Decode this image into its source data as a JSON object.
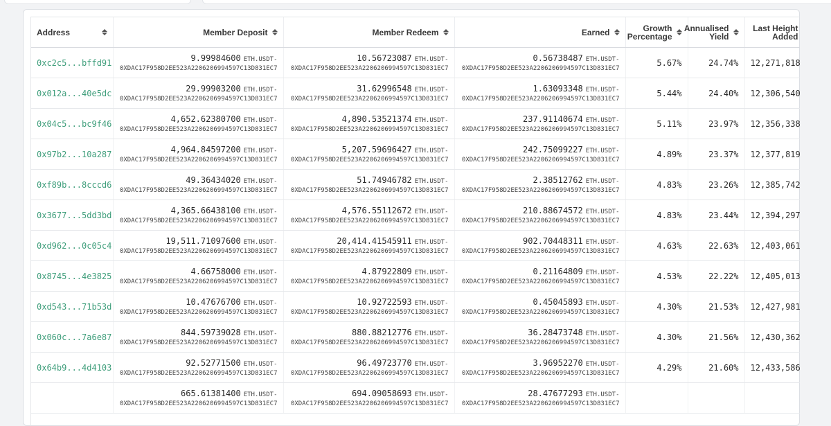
{
  "columns": {
    "address": "Address",
    "deposit": "Member Deposit",
    "redeem": "Member Redeem",
    "earned": "Earned",
    "growth": [
      "Growth",
      "Percentage"
    ],
    "yield": [
      "Annualised",
      "Yield"
    ],
    "height": [
      "Last Height",
      "Added"
    ]
  },
  "token": {
    "prefix": "ETH.USDT-",
    "address": "0XDAC17F958D2EE523A2206206994597C13D831EC7"
  },
  "rows": [
    {
      "address": "0xc2c5...bffd91",
      "deposit": "9.99984600",
      "redeem": "10.56723087",
      "earned": "0.56738487",
      "growth": "5.67%",
      "yield": "24.74%",
      "height": "12,271,818"
    },
    {
      "address": "0x012a...40e5dc",
      "deposit": "29.99903200",
      "redeem": "31.62996548",
      "earned": "1.63093348",
      "growth": "5.44%",
      "yield": "24.40%",
      "height": "12,306,540"
    },
    {
      "address": "0x04c5...bc9f46",
      "deposit": "4,652.62380700",
      "redeem": "4,890.53521374",
      "earned": "237.91140674",
      "growth": "5.11%",
      "yield": "23.97%",
      "height": "12,356,338"
    },
    {
      "address": "0x97b2...10a287",
      "deposit": "4,964.84597200",
      "redeem": "5,207.59696427",
      "earned": "242.75099227",
      "growth": "4.89%",
      "yield": "23.37%",
      "height": "12,377,819"
    },
    {
      "address": "0xf89b...8cccd6",
      "deposit": "49.36434020",
      "redeem": "51.74946782",
      "earned": "2.38512762",
      "growth": "4.83%",
      "yield": "23.26%",
      "height": "12,385,742"
    },
    {
      "address": "0x3677...5dd3bd",
      "deposit": "4,365.66438100",
      "redeem": "4,576.55112672",
      "earned": "210.88674572",
      "growth": "4.83%",
      "yield": "23.44%",
      "height": "12,394,297"
    },
    {
      "address": "0xd962...0c05c4",
      "deposit": "19,511.71097600",
      "redeem": "20,414.41545911",
      "earned": "902.70448311",
      "growth": "4.63%",
      "yield": "22.63%",
      "height": "12,403,061"
    },
    {
      "address": "0x8745...4e3825",
      "deposit": "4.66758000",
      "redeem": "4.87922809",
      "earned": "0.21164809",
      "growth": "4.53%",
      "yield": "22.22%",
      "height": "12,405,013"
    },
    {
      "address": "0xd543...71b53d",
      "deposit": "10.47676700",
      "redeem": "10.92722593",
      "earned": "0.45045893",
      "growth": "4.30%",
      "yield": "21.53%",
      "height": "12,427,981"
    },
    {
      "address": "0x060c...7a6e87",
      "deposit": "844.59739028",
      "redeem": "880.88212776",
      "earned": "36.28473748",
      "growth": "4.30%",
      "yield": "21.56%",
      "height": "12,430,362"
    },
    {
      "address": "0x64b9...4d4103",
      "deposit": "92.52771500",
      "redeem": "96.49723770",
      "earned": "3.96952270",
      "growth": "4.29%",
      "yield": "21.60%",
      "height": "12,433,586"
    },
    {
      "address": "",
      "deposit": "665.61381400",
      "redeem": "694.09058693",
      "earned": "28.47677293",
      "growth": "",
      "yield": "",
      "height": ""
    }
  ]
}
